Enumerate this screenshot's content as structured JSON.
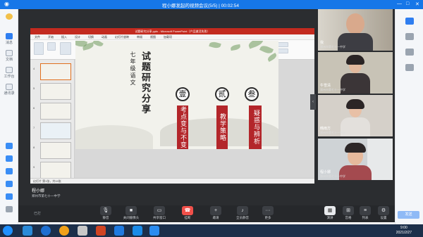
{
  "window": {
    "title": "程小娜发起的视频会议(5/5)",
    "timer": "00:02:54"
  },
  "sidebar": {
    "items": [
      {
        "label": "消息",
        "icon": "chat-icon"
      },
      {
        "label": "文档",
        "icon": "doc-icon"
      },
      {
        "label": "工作台",
        "icon": "workbench-icon"
      },
      {
        "label": "通讯录",
        "icon": "contacts-icon"
      }
    ]
  },
  "ppt": {
    "title_bar": "试题研究分享.pptx - Microsoft PowerPoint（产品激活失败）",
    "tabs": [
      "文件",
      "开始",
      "插入",
      "设计",
      "切换",
      "动画",
      "幻灯片放映",
      "审阅",
      "视图",
      "加载项"
    ],
    "thumb_numbers": [
      "4",
      "5",
      "6",
      "7",
      "8",
      "9"
    ],
    "status": "幻灯片 第1张，共19张"
  },
  "slide": {
    "grade_text": "七年级语文",
    "title": "试题研究分享",
    "medals": [
      "壹",
      "贰",
      "叁"
    ],
    "banners": [
      "考点变与不变",
      "教学策略",
      "疑惑与辨析"
    ]
  },
  "presenter": {
    "name": "程小娜",
    "org": "郑州市第七十一中学"
  },
  "participants": [
    {
      "name": "我",
      "org": "郑州市第七十一中学"
    },
    {
      "name": "牛雪清",
      "org": "郑州市第七十一中学"
    },
    {
      "name": "韩雨方",
      "org": "郑州市第七十一中学"
    },
    {
      "name": "程小娜",
      "org": "郑州市第七十一中学"
    }
  ],
  "controls": {
    "left_label": "已打",
    "buttons": [
      {
        "label": "静音",
        "icon": "mic-icon"
      },
      {
        "label": "关闭摄像头",
        "icon": "camera-icon"
      },
      {
        "label": "共享窗口",
        "icon": "share-icon"
      },
      {
        "label": "挂断",
        "icon": "hangup-icon"
      },
      {
        "label": "邀请",
        "icon": "invite-icon"
      },
      {
        "label": "全员静音",
        "icon": "mute-all-icon"
      },
      {
        "label": "更多",
        "icon": "more-icon"
      }
    ],
    "right_buttons": [
      {
        "label": "演讲",
        "icon": "speaker-view-icon"
      },
      {
        "label": "宫格",
        "icon": "grid-view-icon"
      },
      {
        "label": "列表",
        "icon": "list-icon"
      },
      {
        "label": "设置",
        "icon": "settings-icon"
      }
    ]
  },
  "right_panel": {
    "button_label": "发送"
  },
  "taskbar": {
    "time": "9:00",
    "date": "2021/2/27"
  }
}
